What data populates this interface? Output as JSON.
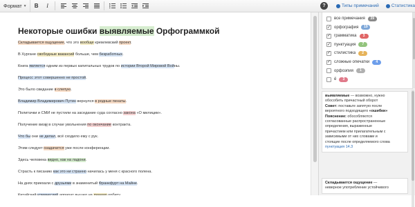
{
  "toolbar": {
    "format_label": "Формат",
    "bold": "B",
    "italic": "I"
  },
  "right_top": {
    "help": "?",
    "types_link": "Типы примечаний",
    "stats_link": "Статистика"
  },
  "document": {
    "title_pre": "Некоторые ошибки ",
    "title_hl": "выявляемые",
    "title_post": " Орфограммкой",
    "paragraphs": [
      [
        [
          "Складывается ощущение",
          "o"
        ],
        [
          ", что это ",
          ""
        ],
        [
          "вообще",
          "y"
        ],
        [
          " кремлевский ",
          ""
        ],
        [
          "проект",
          "o"
        ],
        [
          ".",
          ""
        ]
      ],
      [
        [
          "В Хургане ",
          ""
        ],
        [
          "свободные вакансий",
          "y"
        ],
        [
          " больше, чем ",
          ""
        ],
        [
          "безработных",
          "b"
        ],
        [
          ".",
          ""
        ]
      ],
      [
        [
          "Книга ",
          ""
        ],
        [
          "является",
          "b"
        ],
        [
          " одним из первых капитальных трудов по ",
          ""
        ],
        [
          "истории Второй Мировой Вой",
          "b"
        ],
        [
          "ны",
          ""
        ],
        [
          ".",
          ""
        ]
      ],
      [
        [
          "Процесс этот совершенно не простой",
          "b"
        ],
        [
          ".",
          ""
        ]
      ],
      [
        [
          "Это было свидание ",
          ""
        ],
        [
          "в слепую",
          "o"
        ],
        [
          ".",
          ""
        ]
      ],
      [
        [
          "Владимир Владимирович Путин",
          "b"
        ],
        [
          " вернулся ",
          ""
        ],
        [
          "в родные пенаты",
          "o"
        ],
        [
          ".",
          ""
        ]
      ],
      [
        [
          "Политачки и СМИ не пустили на заседание суда согласно ",
          ""
        ],
        [
          "закона",
          "r"
        ],
        [
          " «О милиции».",
          ""
        ]
      ],
      [
        [
          "Получение виз",
          ""
        ],
        [
          "ы",
          "gy"
        ],
        [
          " в случае увольнения ",
          ""
        ],
        [
          "по окончание",
          "r"
        ],
        [
          " контракта.",
          ""
        ]
      ],
      [
        [
          "Что бы",
          "b"
        ],
        [
          " они ",
          ""
        ],
        [
          "не делал",
          "b"
        ],
        [
          ", всё сходило ему с рук.",
          ""
        ]
      ],
      [
        [
          "Этим следует ",
          ""
        ],
        [
          "озадачится",
          "o"
        ],
        [
          " уже после конференции.",
          ""
        ]
      ],
      [
        [
          "Здесь человека ",
          ""
        ],
        [
          "видно, как на ладони",
          "g"
        ],
        [
          ".",
          ""
        ]
      ],
      [
        [
          "Страсть к писанию ",
          ""
        ],
        [
          "как это ни странно",
          "b"
        ],
        [
          " начилась у меня с красного полена.",
          ""
        ]
      ],
      [
        [
          "На днях приехали с ",
          ""
        ],
        [
          "друзьями",
          "b"
        ],
        [
          " в знаменитый ",
          ""
        ],
        [
          "Франкфурт на Майне",
          "b"
        ],
        [
          ".",
          ""
        ]
      ],
      [
        [
          "Китайский ",
          ""
        ],
        [
          "комический",
          "b"
        ],
        [
          " аппарат вышел на ",
          ""
        ],
        [
          "лунную",
          "y"
        ],
        [
          " орбиту.",
          ""
        ]
      ]
    ]
  },
  "note_types": [
    {
      "label": "все примечания",
      "count": "39",
      "color": "#8a8a8a",
      "checked": false
    },
    {
      "label": "орфография",
      "count": "19",
      "color": "#7ea7d8",
      "checked": true
    },
    {
      "label": "грамматика",
      "count": "3",
      "color": "#e06666",
      "checked": true
    },
    {
      "label": "пунктуация",
      "count": "7",
      "color": "#93c47d",
      "checked": true
    },
    {
      "label": "стилистика",
      "count": "2",
      "color": "#e6b35a",
      "checked": true
    },
    {
      "label": "сложные опечатки",
      "count": "4",
      "color": "#6d9eeb",
      "checked": true
    },
    {
      "label": "орфоэпия",
      "count": "1",
      "color": "#b0b0b0",
      "checked": false
    },
    {
      "label": "ё",
      "count": "3",
      "color": "#e07a8a",
      "checked": false
    }
  ],
  "cards": [
    {
      "lines": [
        [
          [
            "выявляемые",
            "b"
          ],
          [
            " — возможно, нужно",
            ""
          ]
        ],
        [
          [
            "обособить причастный оборот",
            ""
          ]
        ],
        [
          [
            "Совет:",
            "b"
          ],
          [
            " поставьте запятую после",
            ""
          ]
        ],
        [
          [
            "вероятного подходящего ",
            ""
          ],
          [
            "«ошибки»",
            "b"
          ]
        ],
        [
          [
            "Пояснение:",
            "b"
          ],
          [
            " обособляются",
            ""
          ]
        ],
        [
          [
            "согласованные распространенные",
            ""
          ]
        ],
        [
          [
            "определения, выраженные",
            ""
          ]
        ],
        [
          [
            "причастием или прилагательным с",
            ""
          ]
        ],
        [
          [
            "зависимыми от них словами и",
            ""
          ]
        ],
        [
          [
            "стоящие после определяемого слова",
            ""
          ]
        ],
        [
          [
            "пунктуация 14.3",
            "l"
          ]
        ]
      ]
    },
    {
      "lines": [
        [
          [
            "Складывается ощущение",
            "b"
          ],
          [
            " —",
            ""
          ]
        ],
        [
          [
            "неверное употребление устойчивого",
            ""
          ]
        ]
      ]
    }
  ]
}
